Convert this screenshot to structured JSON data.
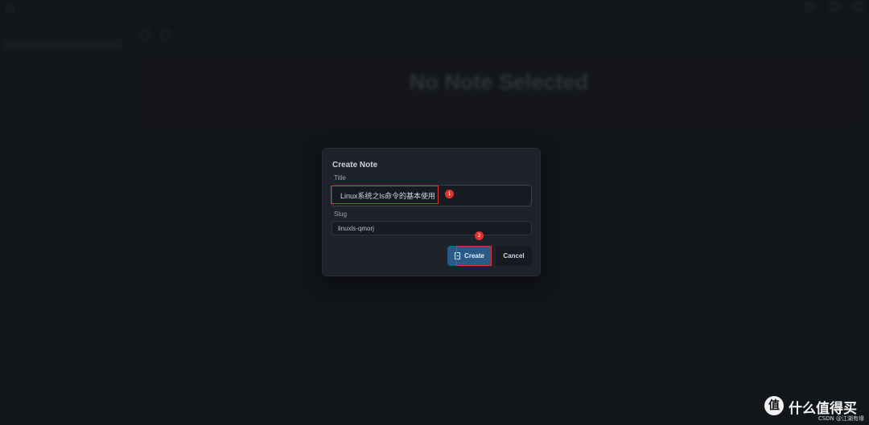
{
  "background": {
    "sidebar": {
      "app_title": "",
      "section_label": "",
      "active_item": "",
      "footer_lines": [
        "",
        ""
      ]
    },
    "topbar": {
      "title": "",
      "link": ""
    },
    "toolbar": {
      "labels": [
        "",
        ""
      ]
    },
    "empty_state": {
      "title": "No Note Selected",
      "subtitle": ""
    }
  },
  "dialog": {
    "title": "Create Note",
    "title_label": "Title",
    "title_value": "Linux系统之ls命令的基本使用",
    "slug_label": "Slug",
    "slug_value": "linuxls-qmorj",
    "create_label": "Create",
    "cancel_label": "Cancel"
  },
  "annotations": {
    "step1": "1",
    "step2": "2"
  },
  "watermark": {
    "logo_glyph": "值",
    "text": "什么值得买",
    "credit": "CSDN @江湖有缘"
  },
  "colors": {
    "accent": "#2b5a86",
    "annotation_red": "#e03131",
    "dialog_bg": "#1e232b",
    "page_bg": "#15181d"
  }
}
